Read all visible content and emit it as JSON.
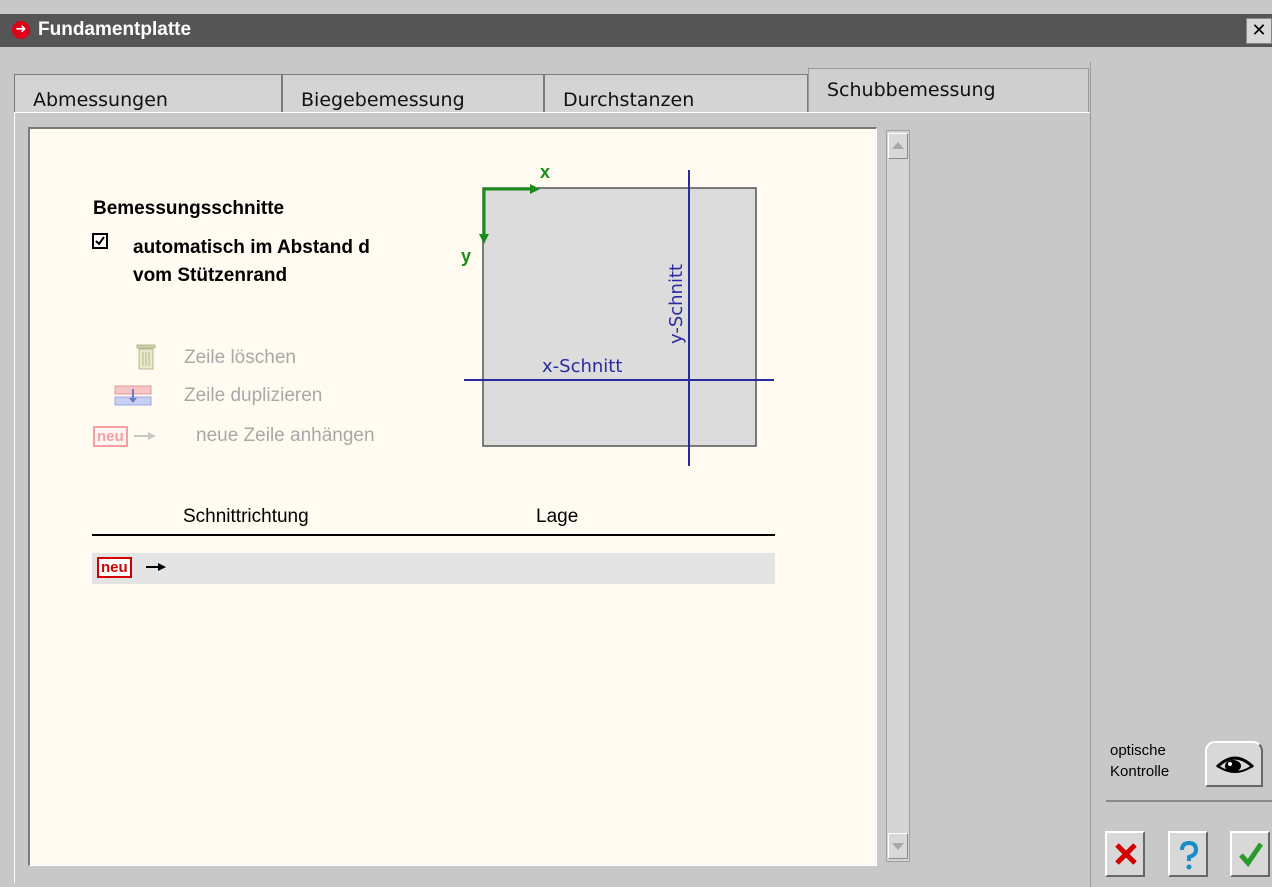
{
  "window": {
    "title": "Fundamentplatte",
    "close_glyph": "✕"
  },
  "tabs": [
    {
      "label": "Abmessungen"
    },
    {
      "label": "Biegebemessung"
    },
    {
      "label": "Durchstanzen"
    },
    {
      "label": "Schubbemessung",
      "active": true
    }
  ],
  "section": {
    "heading": "Bemessungsschnitte",
    "auto_checkbox": {
      "checked": true,
      "label_line1": "automatisch im Abstand d",
      "label_line2": "vom Stützenrand"
    }
  },
  "actions": {
    "delete_row": "Zeile löschen",
    "duplicate_row": "Zeile duplizieren",
    "append_row": "neue Zeile anhängen",
    "neu_badge": "neu"
  },
  "diagram": {
    "x_axis_label": "x",
    "y_axis_label": "y",
    "x_cut_label": "x-Schnitt",
    "y_cut_label": "y-Schnitt"
  },
  "table": {
    "columns": [
      "Schnittrichtung",
      "Lage"
    ],
    "new_row_badge": "neu"
  },
  "sidebar": {
    "optical_check_line1": "optische",
    "optical_check_line2": "Kontrolle"
  },
  "colors": {
    "titlebar": "#555555",
    "panel_bg": "#fffbf0",
    "accent_red": "#d40000",
    "diagram_blue": "#2a2aa0",
    "axis_green": "#1a8c1a"
  }
}
